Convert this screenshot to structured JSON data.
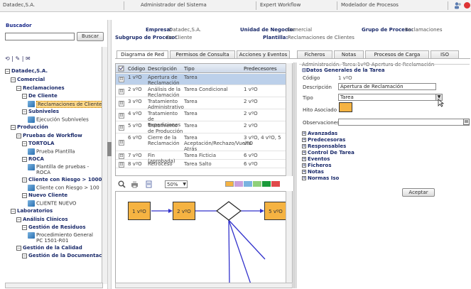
{
  "topbar": {
    "company": "Datadec,S.A.",
    "role": "Administrador del Sistema",
    "product": "Expert Workflow",
    "module": "Modelador de Procesos"
  },
  "sidebar": {
    "search_label": "Buscador",
    "search_value": "",
    "search_button": "Buscar",
    "toolbar_glyphs": "⟲ | ✎ | ✉",
    "tree": [
      {
        "label": "Datadec,S.A.",
        "level": 0,
        "bold": true,
        "pm": "⊟"
      },
      {
        "label": "Comercial",
        "level": 1,
        "bold": true,
        "pm": "⊟"
      },
      {
        "label": "Reclamaciones",
        "level": 2,
        "bold": true,
        "pm": "⊟"
      },
      {
        "label": "De Cliente",
        "level": 3,
        "bold": true,
        "pm": "⊟"
      },
      {
        "label": "Reclamaciones de Cliente",
        "level": 4,
        "bold": false,
        "leaf": true,
        "selected": true
      },
      {
        "label": "Subniveles",
        "level": 3,
        "bold": true,
        "pm": "⊟"
      },
      {
        "label": "Ejecución Subniveles",
        "level": 4,
        "bold": false,
        "leaf": true
      },
      {
        "label": "Producción",
        "level": 1,
        "bold": true,
        "pm": "⊟"
      },
      {
        "label": "Pruebas de Workflow",
        "level": 2,
        "bold": true,
        "pm": "⊟"
      },
      {
        "label": "TORTOLA",
        "level": 3,
        "bold": true,
        "pm": "⊟"
      },
      {
        "label": "Prueba Plantilla",
        "level": 4,
        "bold": false,
        "leaf": true
      },
      {
        "label": "ROCA",
        "level": 3,
        "bold": true,
        "pm": "⊟"
      },
      {
        "label": "Plantilla de pruebas - ROCA",
        "level": 4,
        "bold": false,
        "leaf": true,
        "twoline": true
      },
      {
        "label": "Cliente con Riesgo > 1000",
        "level": 3,
        "bold": true,
        "pm": "⊟"
      },
      {
        "label": "Cliente con Riesgo > 100",
        "level": 4,
        "bold": false,
        "leaf": true
      },
      {
        "label": "Nuevo Cliente",
        "level": 3,
        "bold": true,
        "pm": "⊟"
      },
      {
        "label": "CLIENTE NUEVO",
        "level": 4,
        "bold": false,
        "leaf": true
      },
      {
        "label": "Laboratorios",
        "level": 1,
        "bold": true,
        "pm": "⊟"
      },
      {
        "label": "Análisis Clínicos",
        "level": 2,
        "bold": true,
        "pm": "⊟"
      },
      {
        "label": "Gestión de Residuos",
        "level": 3,
        "bold": true,
        "pm": "⊟"
      },
      {
        "label": "Procedimiento General PC 1501-R01",
        "level": 4,
        "bold": false,
        "leaf": true,
        "twoline": true
      },
      {
        "label": "Gestión de la Calidad",
        "level": 2,
        "bold": true,
        "pm": "⊟"
      },
      {
        "label": "Gestión de la Documentación",
        "level": 3,
        "bold": true,
        "pm": "⊟"
      }
    ]
  },
  "header": {
    "empresa_label": "Empresa:",
    "empresa_value": "Datadec,S.A.",
    "unidad_label": "Unidad de Negocio:",
    "unidad_value": "Comercial",
    "grupo_label": "Grupo de Proceso:",
    "grupo_value": "Reclamaciones",
    "subgrupo_label": "Subgrupo de Proceso:",
    "subgrupo_value": "De Cliente",
    "plantilla_label": "Plantilla:",
    "plantilla_value": "Reclamaciones de Clientes"
  },
  "tabs": [
    "Diagrama de Red",
    "Permisos de Consulta",
    "Acciones y Eventos",
    "Ficheros",
    "Notas",
    "Procesos de Carga",
    "ISO"
  ],
  "grid": {
    "headers": [
      "Código",
      "Descripción",
      "Tipo",
      "Predecesores"
    ],
    "rows": [
      {
        "code": "1 vºO",
        "desc": "Apertura de Reclamación",
        "tipo": "Tarea",
        "pred": ""
      },
      {
        "code": "2 vºO",
        "desc": "Análisis de la Reclamación",
        "tipo": "Tarea Condicional",
        "pred": "1 vºO"
      },
      {
        "code": "3 vºO",
        "desc": "Tratamiento Administrativo",
        "tipo": "Tarea",
        "pred": "2 vºO"
      },
      {
        "code": "4 vºO",
        "desc": "Tratamiento de Expediciones",
        "tipo": "Tarea",
        "pred": "2 vºO"
      },
      {
        "code": "5 vºO",
        "desc": "Tratamiento de Producción",
        "tipo": "Tarea",
        "pred": "2 vºO"
      },
      {
        "code": "6 vºO",
        "desc": "Cierre de la Reclamación",
        "tipo": "Tarea Aceptación/Rechazo/Vuelta Atrás",
        "pred": "3 vºO, 4 vºO, 5 vºO"
      },
      {
        "code": "7 vºO",
        "desc": "Fin (aprobada)",
        "tipo": "Tarea Ficticia",
        "pred": "6 vºO"
      },
      {
        "code": "8 vºO",
        "desc": "Retroceso",
        "tipo": "Tarea Salto",
        "pred": "6 vºO"
      }
    ]
  },
  "diagram_toolbar": {
    "zoom": "50%",
    "swatches": [
      "#f5b342",
      "#c9a0dc",
      "#7ab3e0",
      "#8fd07a",
      "#1a9a3a",
      "#e04a4a"
    ]
  },
  "diagram": {
    "nodes": [
      "1 vºO",
      "2 vºO",
      "5 vºO"
    ]
  },
  "right_panel": {
    "title": "Administración. Tarea:1vºO-Apertura de Reclamación",
    "section": "⊟Datos Generales de la Tarea",
    "codigo_label": "Código",
    "codigo_value": "1 vºO",
    "descripcion_label": "Descripción",
    "descripcion_value": "Apertura de Reclamación",
    "tipo_label": "Tipo",
    "tipo_value": "Tarea",
    "hito_label": "Hito Asociado",
    "hito_color": "#f5b342",
    "observaciones_label": "Observaciones",
    "observaciones_value": "",
    "sections": [
      "Avanzadas",
      "Predecesoras",
      "Responsables",
      "Control De Tarea",
      "Eventos",
      "Ficheros",
      "Notas",
      "Normas Iso"
    ],
    "accept_button": "Aceptar"
  }
}
